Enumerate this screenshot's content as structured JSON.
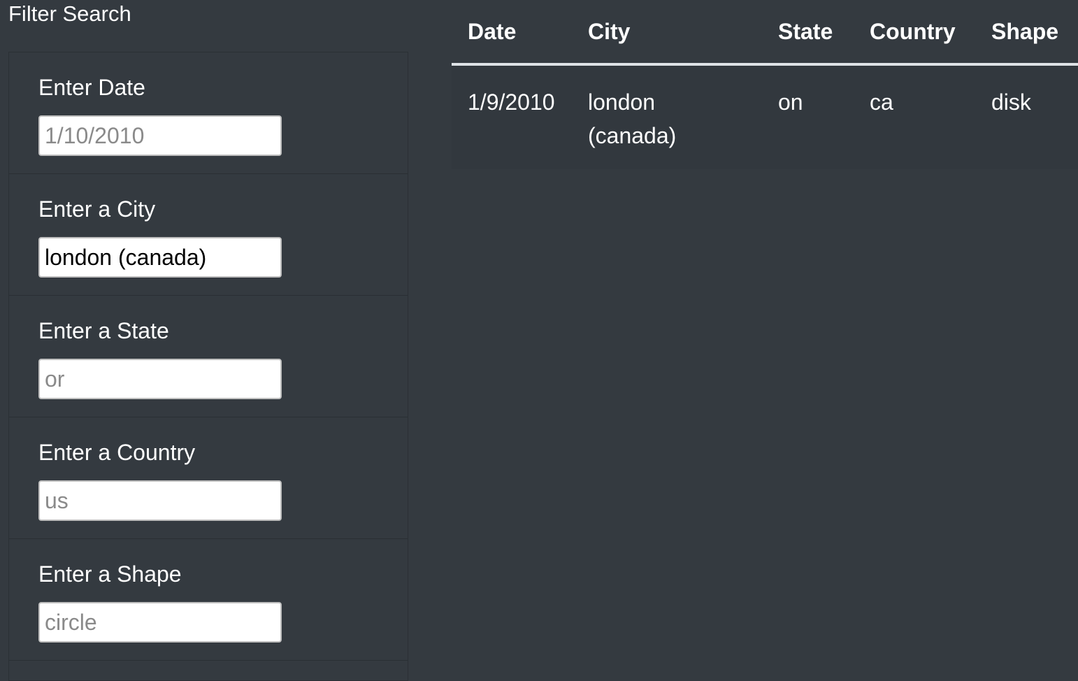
{
  "filter": {
    "title": "Filter Search",
    "fields": [
      {
        "label": "Enter Date",
        "value": "",
        "placeholder": "1/10/2010"
      },
      {
        "label": "Enter a City",
        "value": "london (canada)",
        "placeholder": ""
      },
      {
        "label": "Enter a State",
        "value": "",
        "placeholder": "or"
      },
      {
        "label": "Enter a Country",
        "value": "",
        "placeholder": "us"
      },
      {
        "label": "Enter a Shape",
        "value": "",
        "placeholder": "circle"
      }
    ]
  },
  "table": {
    "headers": [
      "Date",
      "City",
      "State",
      "Country",
      "Shape"
    ],
    "rows": [
      [
        "1/9/2010",
        "london (canada)",
        "on",
        "ca",
        "disk"
      ]
    ]
  },
  "colors": {
    "background": "#343a40",
    "row_background": "#32383e",
    "header_border": "#dee2e6"
  }
}
